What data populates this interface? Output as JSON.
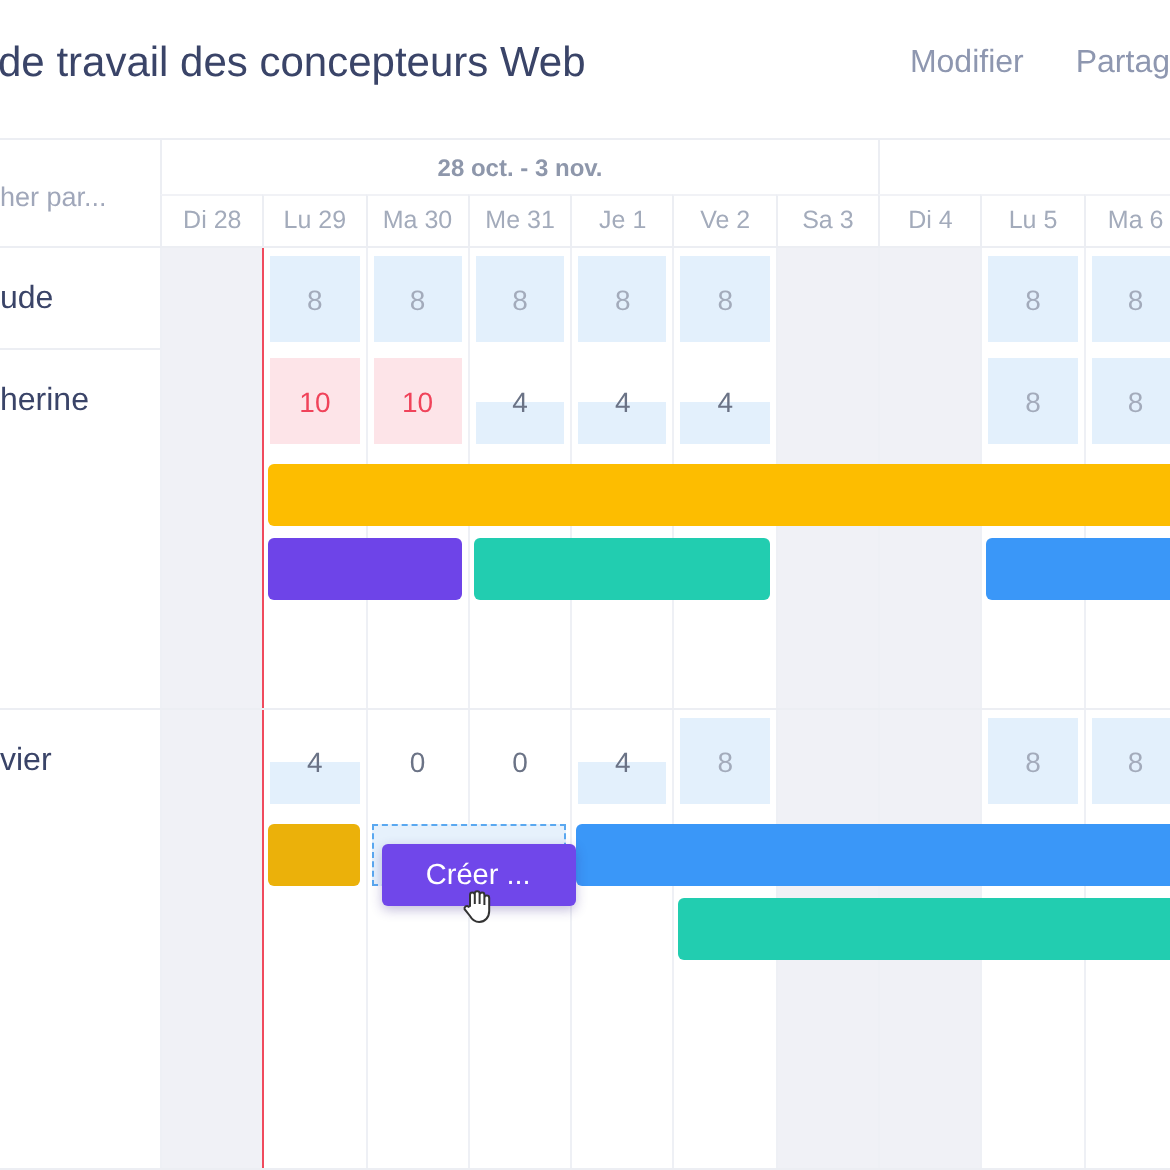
{
  "header": {
    "title": "de travail des concepteurs Web",
    "actions": [
      "Modifier",
      "Partag"
    ]
  },
  "search": {
    "placeholder": "her par..."
  },
  "weeks": [
    {
      "label": "28 oct. - 3 nov.",
      "days": [
        {
          "label": "Di 28",
          "weekend": true,
          "today": false
        },
        {
          "label": "Lu 29",
          "weekend": false,
          "today": true
        },
        {
          "label": "Ma 30",
          "weekend": false,
          "today": false
        },
        {
          "label": "Me 31",
          "weekend": false,
          "today": false
        },
        {
          "label": "Je 1",
          "weekend": false,
          "today": false
        },
        {
          "label": "Ve 2",
          "weekend": false,
          "today": false
        },
        {
          "label": "Sa 3",
          "weekend": true,
          "today": false
        }
      ]
    },
    {
      "days": [
        {
          "label": "Di 4",
          "weekend": true,
          "today": false
        },
        {
          "label": "Lu 5",
          "weekend": false,
          "today": false
        },
        {
          "label": "Ma 6",
          "weekend": false,
          "today": false
        }
      ]
    }
  ],
  "people": [
    {
      "name": "ude",
      "capacity": [
        {
          "kind": "off"
        },
        {
          "kind": "full",
          "hours": "8"
        },
        {
          "kind": "full",
          "hours": "8"
        },
        {
          "kind": "full",
          "hours": "8"
        },
        {
          "kind": "full",
          "hours": "8"
        },
        {
          "kind": "full",
          "hours": "8"
        },
        {
          "kind": "off"
        },
        {
          "kind": "off"
        },
        {
          "kind": "full",
          "hours": "8"
        },
        {
          "kind": "full",
          "hours": "8"
        }
      ]
    },
    {
      "name": "herine",
      "capacity": [
        {
          "kind": "off"
        },
        {
          "kind": "over",
          "hours": "10"
        },
        {
          "kind": "over",
          "hours": "10"
        },
        {
          "kind": "half",
          "hours": "4"
        },
        {
          "kind": "half",
          "hours": "4"
        },
        {
          "kind": "half",
          "hours": "4"
        },
        {
          "kind": "off"
        },
        {
          "kind": "off"
        },
        {
          "kind": "full",
          "hours": "8"
        },
        {
          "kind": "full",
          "hours": "8"
        }
      ],
      "lanes": [
        [
          {
            "kind": "gap"
          },
          {
            "kind": "bar",
            "color": "#fdbd00"
          },
          {
            "kind": "more"
          },
          {
            "kind": "more"
          },
          {
            "kind": "more"
          },
          {
            "kind": "more"
          },
          {
            "kind": "more"
          },
          {
            "kind": "more"
          },
          {
            "kind": "more"
          },
          {
            "kind": "more"
          }
        ],
        [
          {
            "kind": "gap"
          },
          {
            "kind": "bar",
            "color": "#6e44e8"
          },
          {
            "kind": "more"
          },
          {
            "kind": "bar",
            "color": "#22cdb0"
          },
          {
            "kind": "more"
          },
          {
            "kind": "more"
          },
          {
            "kind": "gap"
          },
          {
            "kind": "gap"
          },
          {
            "kind": "bar",
            "color": "#3a97f8"
          },
          {
            "kind": "more"
          }
        ]
      ]
    },
    {
      "name": "vier",
      "capacity": [
        {
          "kind": "off"
        },
        {
          "kind": "half",
          "hours": "4"
        },
        {
          "kind": "none",
          "hours": "0"
        },
        {
          "kind": "none",
          "hours": "0"
        },
        {
          "kind": "half",
          "hours": "4"
        },
        {
          "kind": "full",
          "hours": "8"
        },
        {
          "kind": "off"
        },
        {
          "kind": "off"
        },
        {
          "kind": "full",
          "hours": "8"
        },
        {
          "kind": "full",
          "hours": "8"
        }
      ],
      "lanes": [
        [
          {
            "kind": "gap"
          },
          {
            "kind": "bar",
            "color": "#ebb10a"
          },
          {
            "kind": "draft",
            "label": "Créer ..."
          },
          {
            "kind": "more"
          },
          {
            "kind": "bar",
            "color": "#3a97f8"
          },
          {
            "kind": "more"
          },
          {
            "kind": "more"
          },
          {
            "kind": "more"
          },
          {
            "kind": "more"
          },
          {
            "kind": "more"
          }
        ],
        [
          {
            "kind": "gap"
          },
          {
            "kind": "gap"
          },
          {
            "kind": "gap"
          },
          {
            "kind": "gap"
          },
          {
            "kind": "gap"
          },
          {
            "kind": "bar",
            "color": "#22cdb0"
          },
          {
            "kind": "more"
          },
          {
            "kind": "more"
          },
          {
            "kind": "more"
          },
          {
            "kind": "more"
          }
        ]
      ]
    }
  ]
}
